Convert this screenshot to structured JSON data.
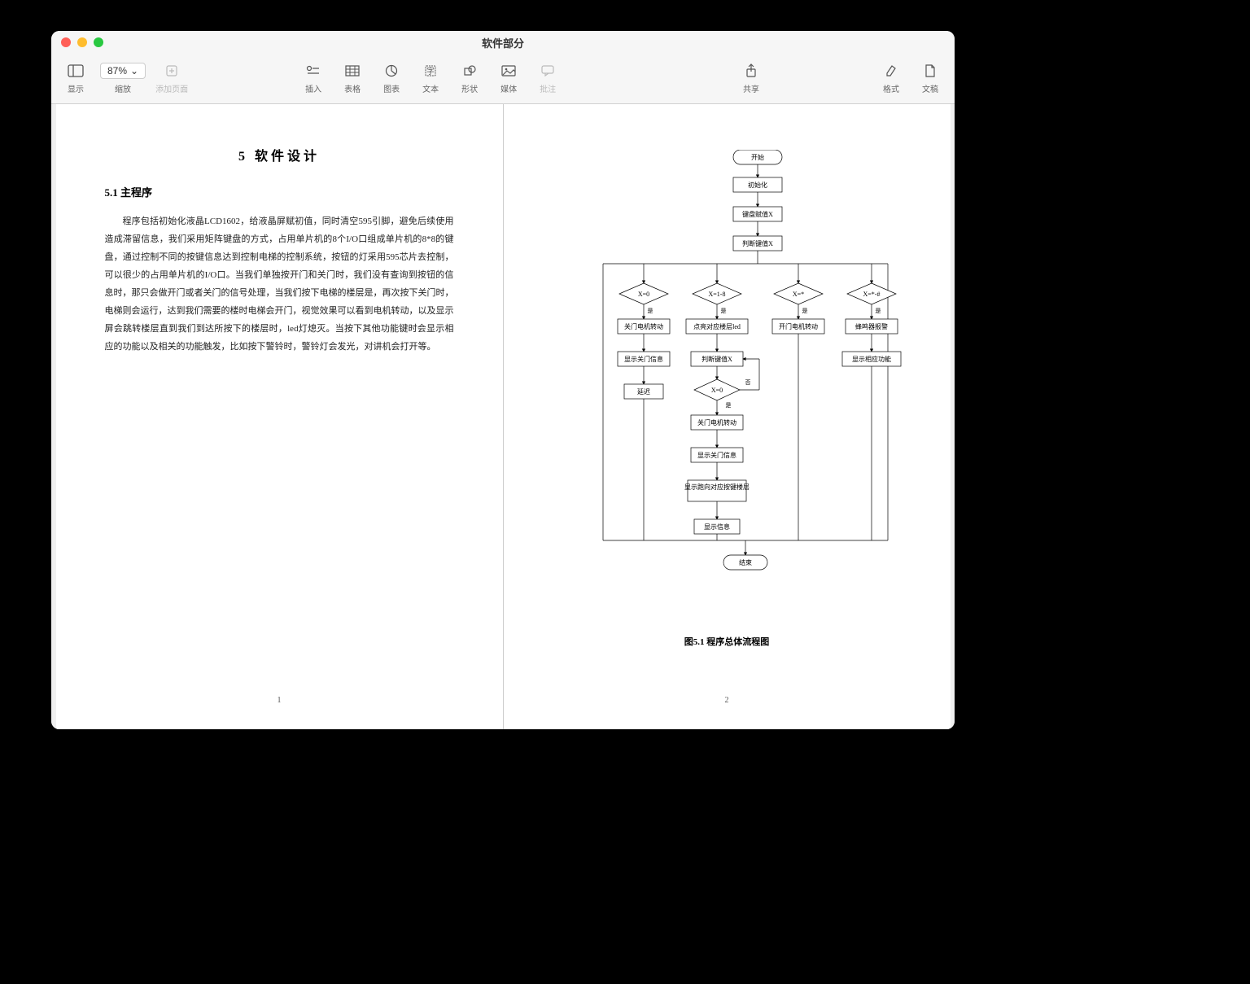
{
  "window": {
    "title": "软件部分"
  },
  "toolbar": {
    "view": "显示",
    "zoom_value": "87%",
    "zoom_label": "缩放",
    "add_page": "添加页面",
    "insert": "插入",
    "table": "表格",
    "chart": "图表",
    "text": "文本",
    "shape": "形状",
    "media": "媒体",
    "comment": "批注",
    "share": "共享",
    "format": "格式",
    "document": "文稿"
  },
  "doc": {
    "chapter_title": "5   软件设计",
    "section_title": "5.1 主程序",
    "body": "程序包括初始化液晶LCD1602，给液晶屏赋初值，同时清空595引脚，避免后续使用造成滞留信息，我们采用矩阵键盘的方式，占用单片机的8个I/O口组成单片机的8*8的键盘，通过控制不同的按键信息达到控制电梯的控制系统，按钮的灯采用595芯片去控制，可以很少的占用单片机的I/O口。当我们单独按开门和关门时，我们没有查询到按钮的信息时，那只会做开门或者关门的信号处理，当我们按下电梯的楼层是，再次按下关门时，电梯则会运行，达到我们需要的楼时电梯会开门，视觉效果可以看到电机转动，以及显示屏会跳转楼层直到我们到达所按下的楼层时，led灯熄灭。当按下其他功能键时会显示相应的功能以及相关的功能触发，比如按下警铃时，警铃灯会发光，对讲机会打开等。",
    "page1_num": "1",
    "page2_num": "2",
    "fig_caption": "图5.1   程序总体流程图"
  },
  "flow": {
    "start": "开始",
    "init": "初始化",
    "keyval": "键盘赋值X",
    "judge": "判断键值X",
    "x0": "X=0",
    "x18": "X=1-8",
    "xstar": "X=*",
    "xhash": "X=*-#",
    "yes": "是",
    "no": "否",
    "close_motor": "关门电机转动",
    "light_led": "点亮对应楼层led",
    "open_motor": "开门电机转动",
    "buzzer": "蜂鸣器报警",
    "show_close": "显示关门信息",
    "judge2": "判断键值X",
    "show_func": "显示相应功能",
    "delay": "延迟",
    "x0b": "X=0",
    "close_motor2": "关门电机转动",
    "show_close2": "显示关门信息",
    "show_jump": "显示跑向对应按键楼层",
    "show_info": "显示信息",
    "end": "结束"
  }
}
